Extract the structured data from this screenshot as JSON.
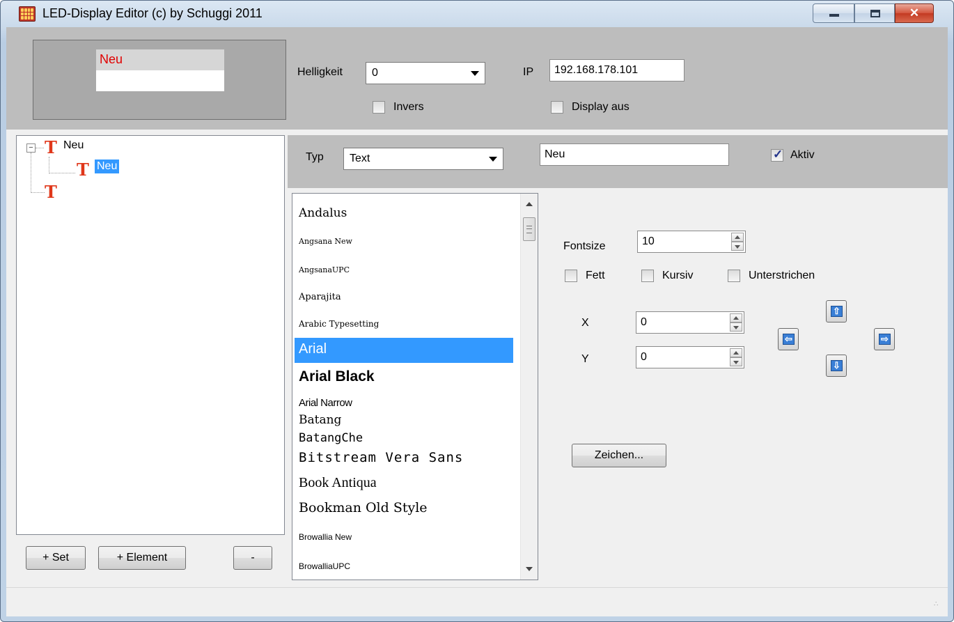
{
  "window": {
    "title": "LED-Display Editor  (c) by Schuggi 2011",
    "close_glyph": "✕"
  },
  "preview": {
    "text": "Neu",
    "text_color": "#e00000"
  },
  "settings": {
    "helligkeit_label": "Helligkeit",
    "helligkeit_value": "0",
    "ip_label": "IP",
    "ip_value": "192.168.178.101",
    "invers_label": "Invers",
    "invers_checked": false,
    "display_aus_label": "Display aus",
    "display_aus_checked": false
  },
  "tree": {
    "expander_glyph": "−",
    "icon_glyph": "T",
    "icon_color": "#e0371a",
    "nodes": [
      {
        "label": "Neu",
        "level": 0,
        "expanded": true
      },
      {
        "label": "Neu",
        "level": 1,
        "selected": true
      },
      {
        "label": "",
        "level": 0
      }
    ]
  },
  "tree_buttons": {
    "add_set": "+ Set",
    "add_element": "+ Element",
    "remove": "-"
  },
  "element": {
    "typ_label": "Typ",
    "typ_value": "Text",
    "text_value": "Neu",
    "aktiv_label": "Aktiv",
    "aktiv_checked": true
  },
  "fonts": {
    "selected": "Arial",
    "items": [
      "Andalus",
      "Angsana New",
      "AngsanaUPC",
      "Aparajita",
      "Arabic Typesetting",
      "Arial",
      "Arial Black",
      "Arial Narrow",
      "Batang",
      "BatangChe",
      "Bitstream Vera Sans",
      "Book Antiqua",
      "Bookman Old Style",
      "Browallia New",
      "BrowalliaUPC"
    ]
  },
  "format": {
    "fontsize_label": "Fontsize",
    "fontsize_value": "10",
    "fett_label": "Fett",
    "fett_checked": false,
    "kursiv_label": "Kursiv",
    "kursiv_checked": false,
    "unterstrichen_label": "Unterstrichen",
    "unterstrichen_checked": false,
    "x_label": "X",
    "x_value": "0",
    "y_label": "Y",
    "y_value": "0",
    "zeichen_button": "Zeichen...",
    "move_icons": {
      "up": "arrow-up-icon",
      "down": "arrow-down-icon",
      "left": "arrow-left-icon",
      "right": "arrow-right-icon"
    },
    "arrow_glyphs": {
      "up": "⇧",
      "down": "⇩",
      "left": "⇦",
      "right": "⇨"
    }
  },
  "statusbar": {
    "grip_glyph": "∴"
  }
}
